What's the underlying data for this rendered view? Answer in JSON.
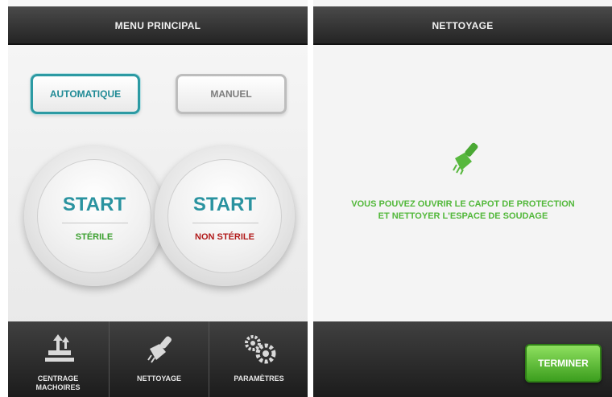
{
  "left_screen": {
    "title": "MENU PRINCIPAL",
    "mode_buttons": [
      {
        "label": "AUTOMATIQUE",
        "selected": true
      },
      {
        "label": "MANUEL",
        "selected": false
      }
    ],
    "start_buttons": [
      {
        "label": "START",
        "sub_label": "STÉRILE",
        "sub_color": "#3a9f2e"
      },
      {
        "label": "START",
        "sub_label": "NON STÉRILE",
        "sub_color": "#b11a1a"
      }
    ],
    "nav": [
      {
        "label_line1": "CENTRAGE",
        "label_line2": "MACHOIRES",
        "icon": "centering-jaws-icon"
      },
      {
        "label_line1": "NETTOYAGE",
        "label_line2": "",
        "icon": "brush-icon"
      },
      {
        "label_line1": "PARAMÈTRES",
        "label_line2": "",
        "icon": "gears-icon"
      }
    ]
  },
  "right_screen": {
    "title": "NETTOYAGE",
    "icon": "brush-icon",
    "message_line1": "VOUS POUVEZ OUVRIR LE CAPOT DE PROTECTION",
    "message_line2": "ET NETTOYER L'ESPACE DE SOUDAGE",
    "finish_button": "TERMINER"
  },
  "colors": {
    "accent_teal": "#2a93a0",
    "green": "#52b83a",
    "red": "#b11a1a",
    "header_dark": "#222222"
  }
}
